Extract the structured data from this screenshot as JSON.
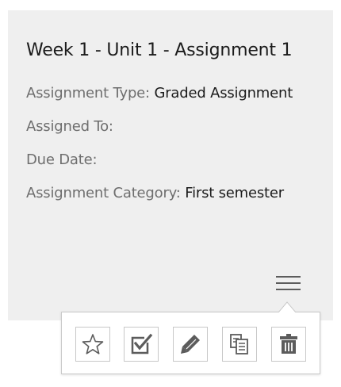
{
  "card": {
    "title": "Week 1 - Unit 1 - Assignment 1",
    "fields": {
      "type_label": "Assignment Type:",
      "type_value": "Graded Assignment",
      "assigned_label": "Assigned To:",
      "assigned_value": "",
      "due_label": "Due Date:",
      "due_value": "",
      "category_label": "Assignment Category:",
      "category_value": "First semester"
    }
  },
  "menu": {
    "toggle_icon": "hamburger-menu-icon"
  },
  "actions": [
    {
      "icon": "star-icon"
    },
    {
      "icon": "checkbox-checked-icon"
    },
    {
      "icon": "pencil-icon"
    },
    {
      "icon": "copy-icon"
    },
    {
      "icon": "trash-icon"
    }
  ],
  "colors": {
    "card_background": "#efefef",
    "label_text": "#6e6e6e",
    "value_text": "#1b1b1b",
    "icon": "#5c5c5c",
    "border": "#c8c8c8"
  }
}
